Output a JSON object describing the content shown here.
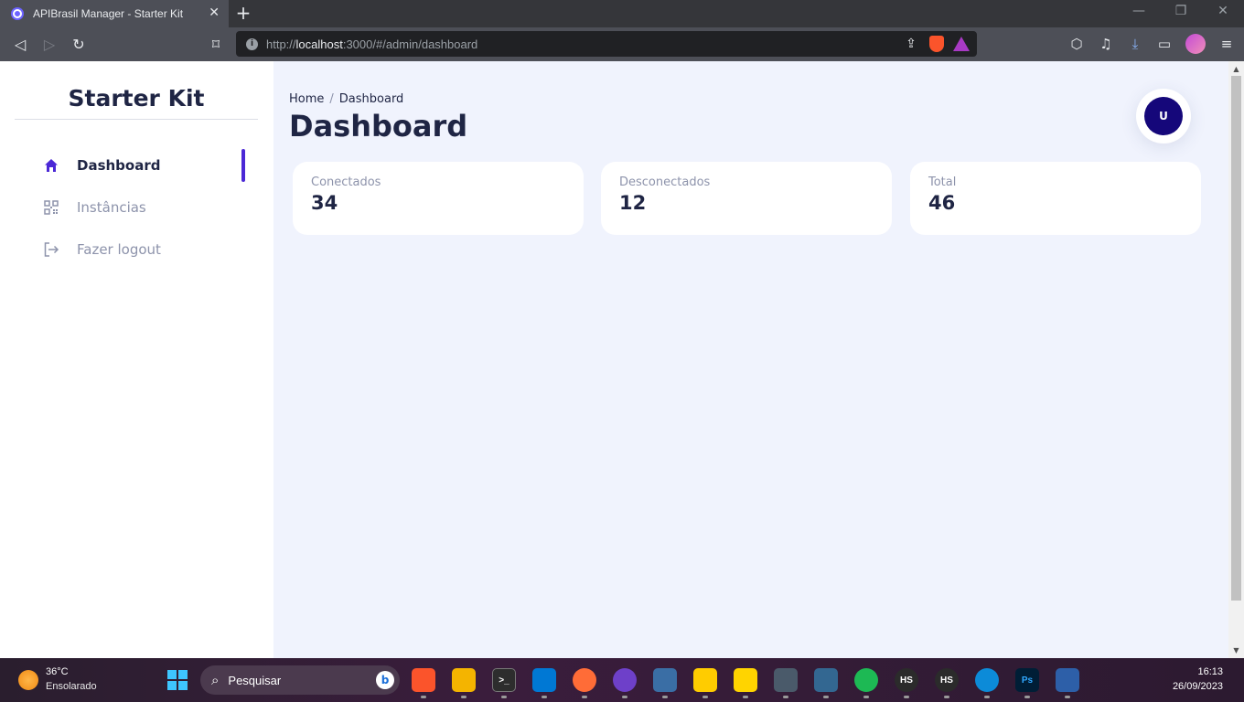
{
  "browser": {
    "tab_title": "APIBrasil Manager - Starter Kit",
    "tab_close": "✕",
    "new_tab": "+",
    "url_prefix": "http://",
    "url_host": "localhost",
    "url_rest": ":3000/#/admin/dashboard",
    "back": "◁",
    "forward": "▷",
    "reload": "↻",
    "bookmark": "⌑",
    "minimize": "—",
    "maximize": "❐",
    "close": "✕"
  },
  "sidebar": {
    "brand": "Starter Kit",
    "items": [
      {
        "label": "Dashboard",
        "icon": "home-icon",
        "active": true
      },
      {
        "label": "Instâncias",
        "icon": "qrcode-icon",
        "active": false
      },
      {
        "label": "Fazer logout",
        "icon": "logout-icon",
        "active": false
      }
    ]
  },
  "header": {
    "breadcrumb": [
      "Home",
      "Dashboard"
    ],
    "breadcrumb_sep": "/",
    "title": "Dashboard",
    "avatar_initial": "U"
  },
  "stats": [
    {
      "label": "Conectados",
      "value": "34"
    },
    {
      "label": "Desconectados",
      "value": "12"
    },
    {
      "label": "Total",
      "value": "46"
    }
  ],
  "taskbar": {
    "weather_temp": "36°C",
    "weather_desc": "Ensolarado",
    "search_placeholder": "Pesquisar",
    "time": "16:13",
    "date": "26/09/2023"
  },
  "colors": {
    "accent": "#4b28d6",
    "page_bg": "#f0f3fd",
    "text_dark": "#1f2544",
    "text_muted": "#8d93ab",
    "avatar_bg": "#15077a"
  }
}
